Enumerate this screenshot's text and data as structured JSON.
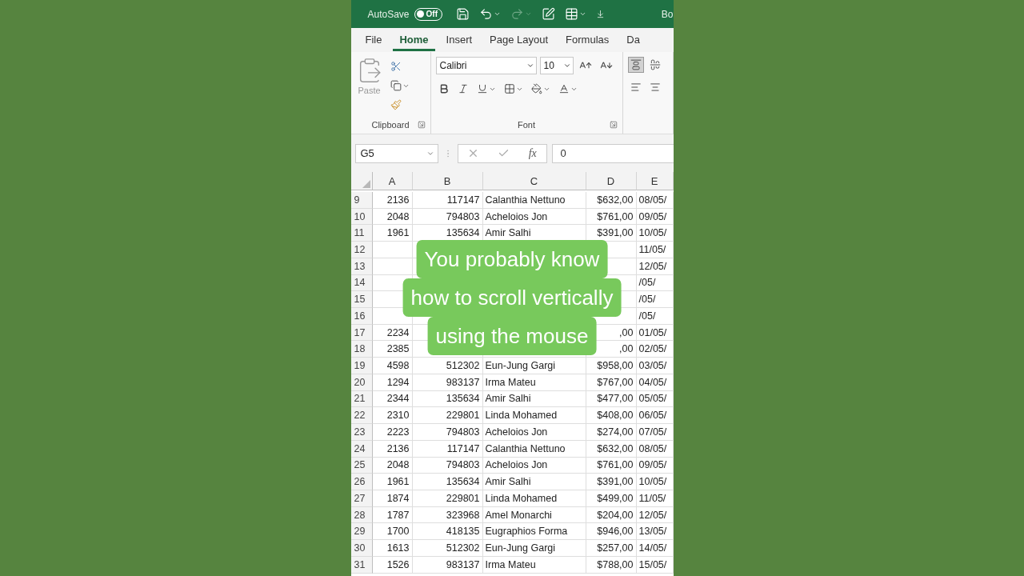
{
  "title_bar": {
    "autosave_label": "AutoSave",
    "autosave": {
      "on": false,
      "label": "Off"
    },
    "quick_access": [
      {
        "kind": "save",
        "disabled": false
      },
      {
        "kind": "undo",
        "disabled": false
      },
      {
        "kind": "redo",
        "disabled": true
      },
      {
        "kind": "form",
        "disabled": false
      },
      {
        "kind": "sheet",
        "disabled": false
      },
      {
        "kind": "customize",
        "disabled": false
      }
    ],
    "title": "Bo"
  },
  "tabs": [
    {
      "label": "File",
      "selected": false
    },
    {
      "label": "Home",
      "selected": true
    },
    {
      "label": "Insert",
      "selected": false
    },
    {
      "label": "Page Layout",
      "selected": false
    },
    {
      "label": "Formulas",
      "selected": false
    },
    {
      "label": "Da",
      "selected": false
    }
  ],
  "ribbon": {
    "clipboard": {
      "paste": {
        "label": "Paste",
        "disabled": true
      },
      "group_label": "Clipboard"
    },
    "font": {
      "font_name": "Calibri",
      "font_size": "10",
      "group_label": "Font"
    },
    "alignment_buttons": [
      {
        "selected": true
      },
      {
        "selected": false
      },
      {
        "selected": false
      },
      {
        "selected": false
      }
    ]
  },
  "formula_bar": {
    "name_box": "G5",
    "function_label": "fx",
    "value": "0"
  },
  "columns": [
    "A",
    "B",
    "C",
    "D",
    "E"
  ],
  "rows": [
    {
      "number": "9",
      "cells": [
        "2136",
        "117147",
        "Calanthia Nettuno",
        "$632,00",
        "08/05/"
      ]
    },
    {
      "number": "10",
      "cells": [
        "2048",
        "794803",
        "Acheloios Jon",
        "$761,00",
        "09/05/"
      ]
    },
    {
      "number": "11",
      "cells": [
        "1961",
        "135634",
        "Amir Salhi",
        "$391,00",
        "10/05/"
      ]
    },
    {
      "number": "12",
      "cells": [
        null,
        null,
        null,
        null,
        "11/05/"
      ]
    },
    {
      "number": "13",
      "cells": [
        null,
        null,
        null,
        null,
        "12/05/"
      ]
    },
    {
      "number": "14",
      "cells": [
        null,
        null,
        null,
        null,
        "/05/"
      ]
    },
    {
      "number": "15",
      "cells": [
        null,
        null,
        null,
        null,
        "/05/"
      ]
    },
    {
      "number": "16",
      "cells": [
        null,
        null,
        null,
        null,
        "/05/"
      ]
    },
    {
      "number": "17",
      "cells": [
        "2234",
        null,
        null,
        ",00",
        "01/05/"
      ]
    },
    {
      "number": "18",
      "cells": [
        "2385",
        null,
        null,
        ",00",
        "02/05/"
      ]
    },
    {
      "number": "19",
      "cells": [
        "4598",
        "512302",
        "Eun-Jung Gargi",
        "$958,00",
        "03/05/"
      ]
    },
    {
      "number": "20",
      "cells": [
        "1294",
        "983137",
        "Irma Mateu",
        "$767,00",
        "04/05/"
      ]
    },
    {
      "number": "21",
      "cells": [
        "2344",
        "135634",
        "Amir Salhi",
        "$477,00",
        "05/05/"
      ]
    },
    {
      "number": "22",
      "cells": [
        "2310",
        "229801",
        "Linda Mohamed",
        "$408,00",
        "06/05/"
      ]
    },
    {
      "number": "23",
      "cells": [
        "2223",
        "794803",
        "Acheloios Jon",
        "$274,00",
        "07/05/"
      ]
    },
    {
      "number": "24",
      "cells": [
        "2136",
        "117147",
        "Calanthia Nettuno",
        "$632,00",
        "08/05/"
      ]
    },
    {
      "number": "25",
      "cells": [
        "2048",
        "794803",
        "Acheloios Jon",
        "$761,00",
        "09/05/"
      ]
    },
    {
      "number": "26",
      "cells": [
        "1961",
        "135634",
        "Amir Salhi",
        "$391,00",
        "10/05/"
      ]
    },
    {
      "number": "27",
      "cells": [
        "1874",
        "229801",
        "Linda Mohamed",
        "$499,00",
        "11/05/"
      ]
    },
    {
      "number": "28",
      "cells": [
        "1787",
        "323968",
        "Amel Monarchi",
        "$204,00",
        "12/05/"
      ]
    },
    {
      "number": "29",
      "cells": [
        "1700",
        "418135",
        "Eugraphios Forma",
        "$946,00",
        "13/05/"
      ]
    },
    {
      "number": "30",
      "cells": [
        "1613",
        "512302",
        "Eun-Jung Gargi",
        "$257,00",
        "14/05/"
      ]
    },
    {
      "number": "31",
      "cells": [
        "1526",
        "983137",
        "Irma Mateu",
        "$788,00",
        "15/05/"
      ]
    }
  ],
  "caption": {
    "lines": [
      "You probably know",
      "how to scroll vertically",
      "using the mouse"
    ]
  }
}
